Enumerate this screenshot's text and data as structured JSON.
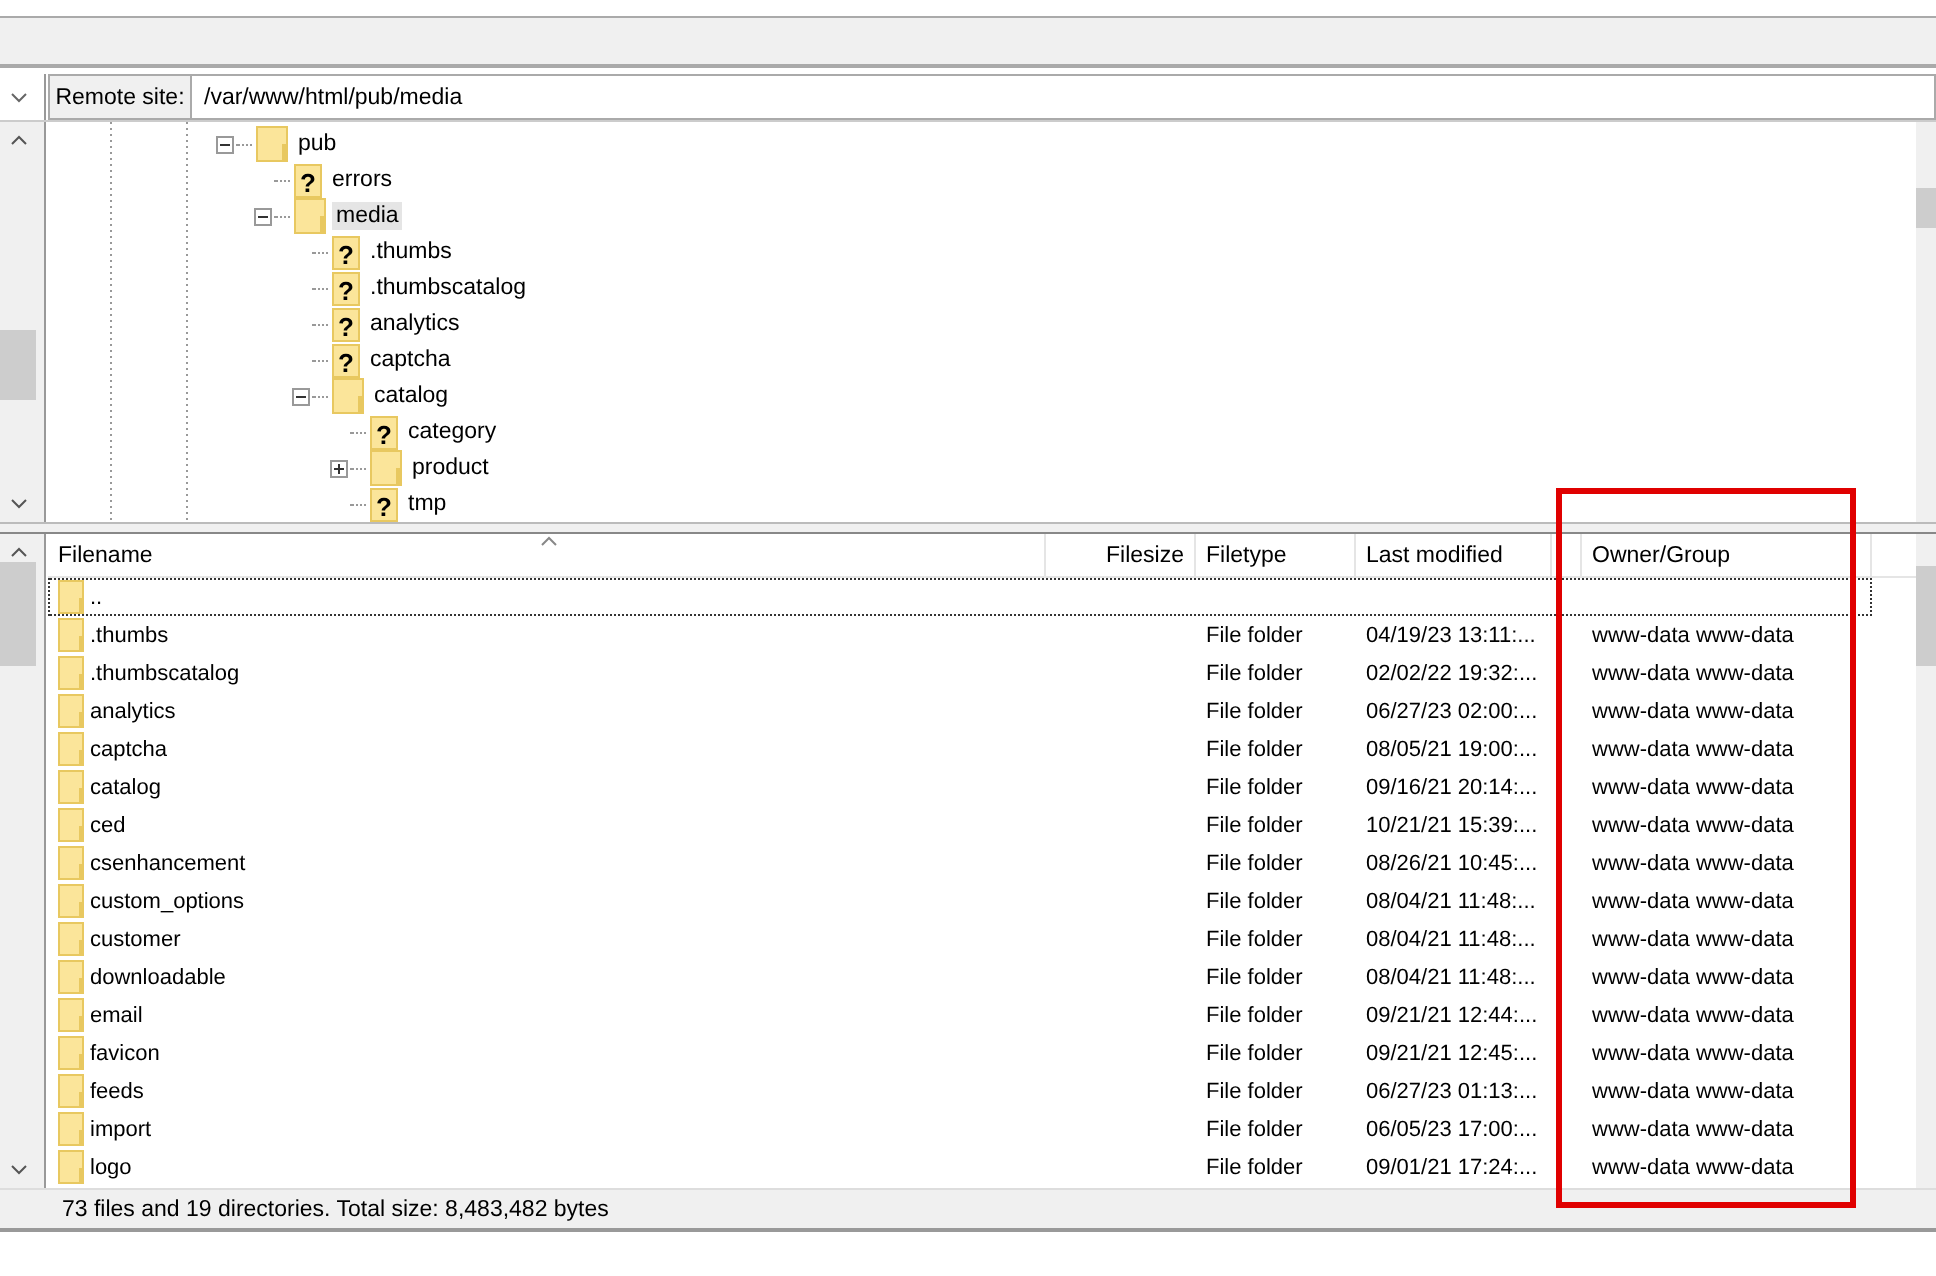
{
  "remote_site": {
    "label": "Remote site:",
    "path": "/var/www/html/pub/media"
  },
  "tree": [
    {
      "name": "pub",
      "kind": "folder",
      "expanded": true,
      "selected": false,
      "children": [
        {
          "name": "errors",
          "kind": "unknown",
          "icon_text": "?",
          "selected": false
        },
        {
          "name": "media",
          "kind": "folder",
          "expanded": true,
          "selected": true,
          "children": [
            {
              "name": ".thumbs",
              "kind": "unknown",
              "icon_text": "?",
              "selected": false
            },
            {
              "name": ".thumbscatalog",
              "kind": "unknown",
              "icon_text": "?",
              "selected": false
            },
            {
              "name": "analytics",
              "kind": "unknown",
              "icon_text": "?",
              "selected": false
            },
            {
              "name": "captcha",
              "kind": "unknown",
              "icon_text": "?",
              "selected": false
            },
            {
              "name": "catalog",
              "kind": "folder",
              "expanded": true,
              "selected": false,
              "children": [
                {
                  "name": "category",
                  "kind": "unknown",
                  "icon_text": "?",
                  "selected": false
                },
                {
                  "name": "product",
                  "kind": "folder",
                  "expanded": false,
                  "selected": false
                },
                {
                  "name": "tmp",
                  "kind": "unknown",
                  "icon_text": "?",
                  "selected": false
                }
              ]
            }
          ]
        }
      ]
    }
  ],
  "file_list": {
    "columns": [
      "Filename",
      "Filesize",
      "Filetype",
      "Last modified",
      "Owner/Group"
    ],
    "rows": [
      {
        "name": "..",
        "focused": true
      },
      {
        "name": ".thumbs",
        "type": "File folder",
        "modified": "04/19/23 13:11:...",
        "owner": "www-data www-data",
        "focused": false
      },
      {
        "name": ".thumbscatalog",
        "type": "File folder",
        "modified": "02/02/22 19:32:...",
        "owner": "www-data www-data",
        "focused": false
      },
      {
        "name": "analytics",
        "type": "File folder",
        "modified": "06/27/23 02:00:...",
        "owner": "www-data www-data",
        "focused": false
      },
      {
        "name": "captcha",
        "type": "File folder",
        "modified": "08/05/21 19:00:...",
        "owner": "www-data www-data",
        "focused": false
      },
      {
        "name": "catalog",
        "type": "File folder",
        "modified": "09/16/21 20:14:...",
        "owner": "www-data www-data",
        "focused": false
      },
      {
        "name": "ced",
        "type": "File folder",
        "modified": "10/21/21 15:39:...",
        "owner": "www-data www-data",
        "focused": false
      },
      {
        "name": "csenhancement",
        "type": "File folder",
        "modified": "08/26/21 10:45:...",
        "owner": "www-data www-data",
        "focused": false
      },
      {
        "name": "custom_options",
        "type": "File folder",
        "modified": "08/04/21 11:48:...",
        "owner": "www-data www-data",
        "focused": false
      },
      {
        "name": "customer",
        "type": "File folder",
        "modified": "08/04/21 11:48:...",
        "owner": "www-data www-data",
        "focused": false
      },
      {
        "name": "downloadable",
        "type": "File folder",
        "modified": "08/04/21 11:48:...",
        "owner": "www-data www-data",
        "focused": false
      },
      {
        "name": "email",
        "type": "File folder",
        "modified": "09/21/21 12:44:...",
        "owner": "www-data www-data",
        "focused": false
      },
      {
        "name": "favicon",
        "type": "File folder",
        "modified": "09/21/21 12:45:...",
        "owner": "www-data www-data",
        "focused": false
      },
      {
        "name": "feeds",
        "type": "File folder",
        "modified": "06/27/23 01:13:...",
        "owner": "www-data www-data",
        "focused": false
      },
      {
        "name": "import",
        "type": "File folder",
        "modified": "06/05/23 17:00:...",
        "owner": "www-data www-data",
        "focused": false
      },
      {
        "name": "logo",
        "type": "File folder",
        "modified": "09/01/21 17:24:...",
        "owner": "www-data www-data",
        "focused": false
      }
    ]
  },
  "status_bar": "73 files and 19 directories. Total size: 8,483,482 bytes"
}
